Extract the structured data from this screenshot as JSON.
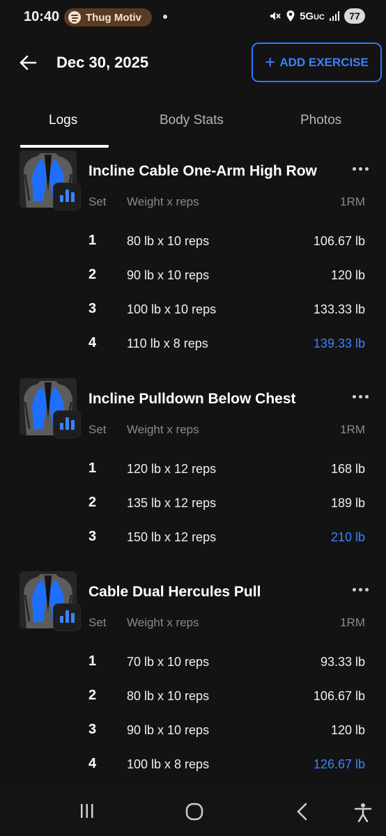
{
  "status_bar": {
    "time": "10:40",
    "media_app_icon": "spotify-icon",
    "media_text": "Thug Motiv",
    "network": "5G",
    "network_suffix": "UC",
    "battery": "77"
  },
  "header": {
    "back_icon": "arrow-left-icon",
    "title": "Dec 30, 2025",
    "add_button_label": "ADD EXERCISE"
  },
  "tabs": [
    {
      "label": "Logs",
      "active": true
    },
    {
      "label": "Body Stats",
      "active": false
    },
    {
      "label": "Photos",
      "active": false
    }
  ],
  "table_headers": {
    "set": "Set",
    "weight_reps": "Weight x reps",
    "one_rm": "1RM"
  },
  "exercises": [
    {
      "name": "Incline Cable One-Arm High Row",
      "sets": [
        {
          "set": "1",
          "weight_reps": "80 lb x 10 reps",
          "one_rm": "106.67 lb",
          "best": false
        },
        {
          "set": "2",
          "weight_reps": "90 lb x 10 reps",
          "one_rm": "120 lb",
          "best": false
        },
        {
          "set": "3",
          "weight_reps": "100 lb x 10 reps",
          "one_rm": "133.33 lb",
          "best": false
        },
        {
          "set": "4",
          "weight_reps": "110 lb x 8 reps",
          "one_rm": "139.33 lb",
          "best": true
        }
      ]
    },
    {
      "name": "Incline Pulldown Below Chest",
      "sets": [
        {
          "set": "1",
          "weight_reps": "120 lb x 12 reps",
          "one_rm": "168 lb",
          "best": false
        },
        {
          "set": "2",
          "weight_reps": "135 lb x 12 reps",
          "one_rm": "189 lb",
          "best": false
        },
        {
          "set": "3",
          "weight_reps": "150 lb x 12 reps",
          "one_rm": "210 lb",
          "best": true
        }
      ]
    },
    {
      "name": "Cable Dual Hercules Pull",
      "sets": [
        {
          "set": "1",
          "weight_reps": "70 lb x 10 reps",
          "one_rm": "93.33 lb",
          "best": false
        },
        {
          "set": "2",
          "weight_reps": "80 lb x 10 reps",
          "one_rm": "106.67 lb",
          "best": false
        },
        {
          "set": "3",
          "weight_reps": "90 lb x 10 reps",
          "one_rm": "120 lb",
          "best": false
        },
        {
          "set": "4",
          "weight_reps": "100 lb x 8 reps",
          "one_rm": "126.67 lb",
          "best": true
        }
      ]
    }
  ],
  "colors": {
    "accent": "#3b82ff",
    "background": "#131313",
    "muted_text": "#8a8a8a"
  },
  "nav_bar": {
    "recents_icon": "recents-icon",
    "home_icon": "home-icon",
    "back_icon": "back-chevron-icon",
    "accessibility_icon": "accessibility-icon"
  }
}
